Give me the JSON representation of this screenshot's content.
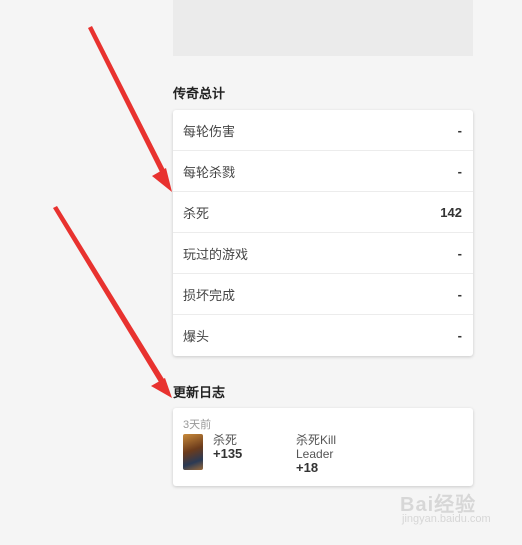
{
  "legend_totals": {
    "title": "传奇总计",
    "rows": [
      {
        "label": "每轮伤害",
        "value": "-"
      },
      {
        "label": "每轮杀戮",
        "value": "-"
      },
      {
        "label": "杀死",
        "value": "142"
      },
      {
        "label": "玩过的游戏",
        "value": "-"
      },
      {
        "label": "损坏完成",
        "value": "-"
      },
      {
        "label": "爆头",
        "value": "-"
      }
    ]
  },
  "changelog": {
    "title": "更新日志",
    "time": "3天前",
    "entries": [
      {
        "label": "杀死",
        "delta": "+135"
      },
      {
        "label": "杀死Kill Leader",
        "delta": "+18"
      }
    ]
  },
  "watermark": {
    "text": "Bai经验",
    "sub": "jingyan.baidu.com"
  },
  "colors": {
    "arrow": "#e8322f",
    "background": "#f5f5f5",
    "card": "#ffffff"
  }
}
